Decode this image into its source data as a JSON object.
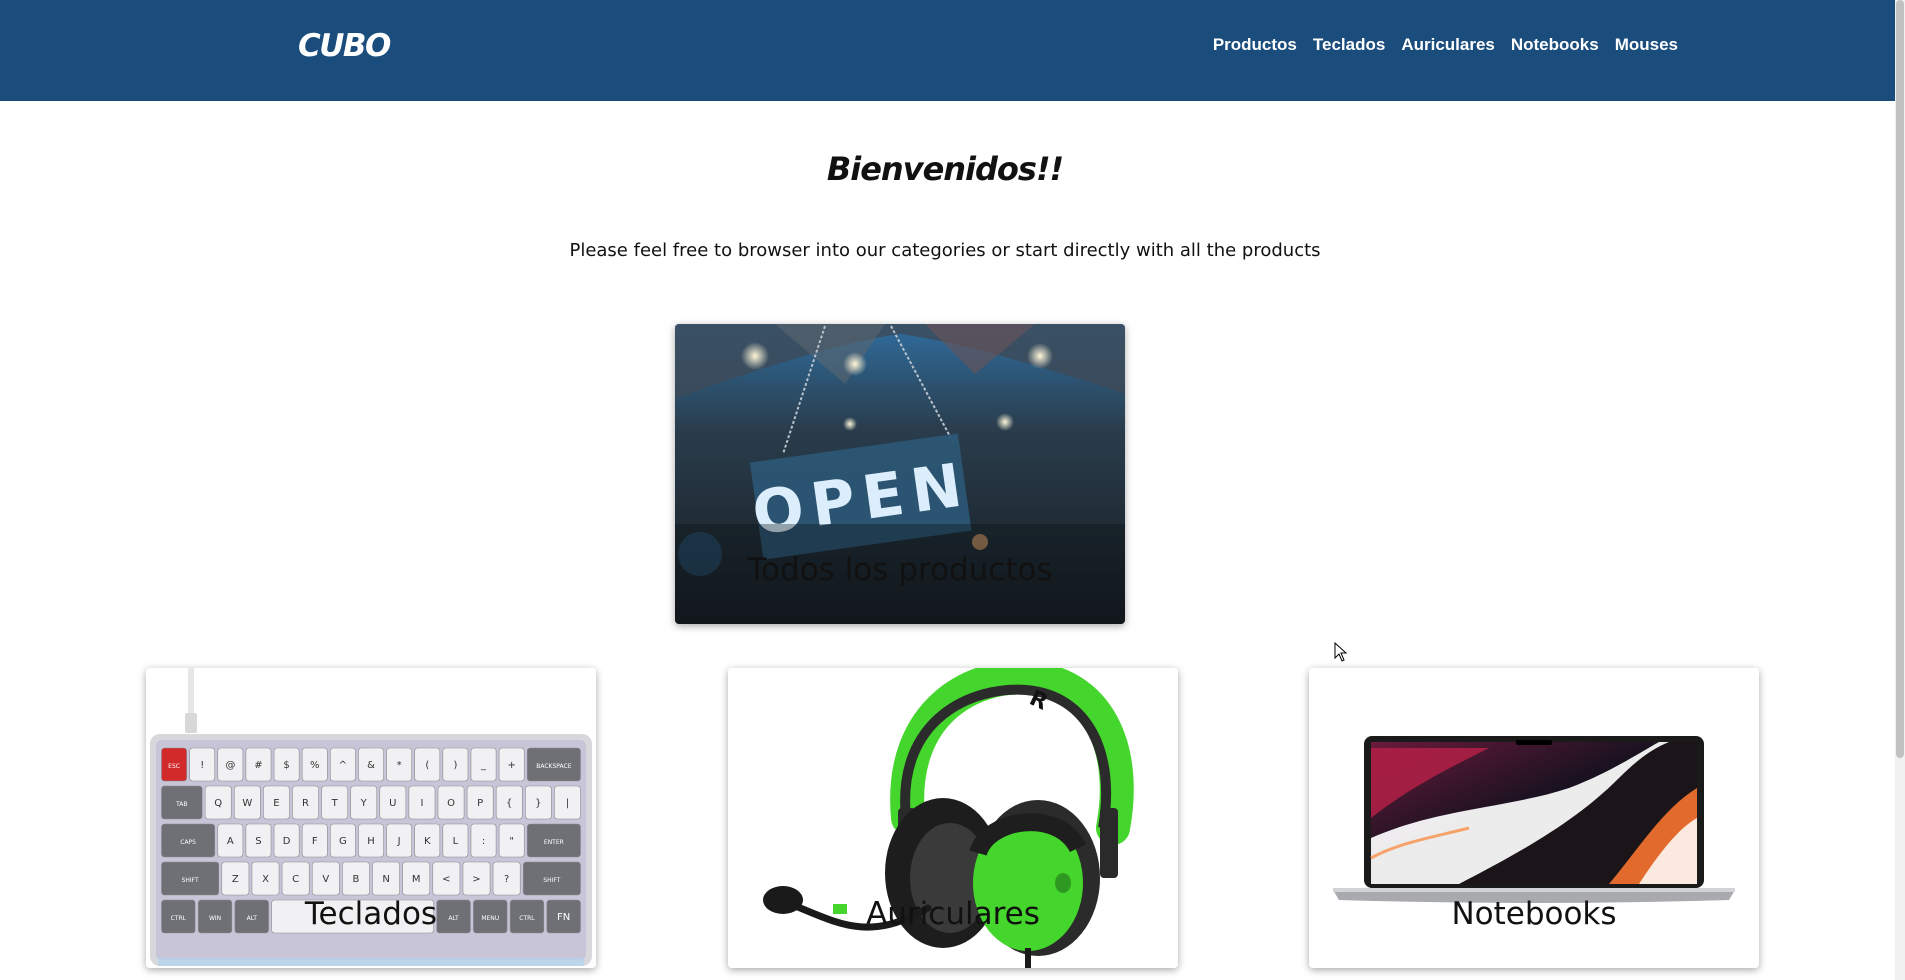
{
  "header": {
    "brand": "CUBO",
    "nav": [
      {
        "label": "Productos"
      },
      {
        "label": "Teclados"
      },
      {
        "label": "Auriculares"
      },
      {
        "label": "Notebooks"
      },
      {
        "label": "Mouses"
      }
    ],
    "background_color": "#1a4c7c"
  },
  "hero": {
    "title": "Bienvenidos!!",
    "subtitle": "Please feel free to browser into our categories or start directly with all the products"
  },
  "categories": {
    "all": {
      "label": "Todos los productos",
      "sign_text": "OPEN",
      "image": "open-sign-photo"
    },
    "items": [
      {
        "label": "Teclados",
        "image": "keyboard-photo"
      },
      {
        "label": "Auriculares",
        "image": "headphones-photo"
      },
      {
        "label": "Notebooks",
        "image": "laptop-photo"
      }
    ]
  },
  "keyboard_keys": {
    "row1": [
      "ESC",
      "!",
      "@",
      "#",
      "$",
      "%",
      "^",
      "&",
      "*",
      "(",
      ")",
      "_",
      "+",
      "BACKSPACE"
    ],
    "row2": [
      "TAB",
      "Q",
      "W",
      "E",
      "R",
      "T",
      "Y",
      "U",
      "I",
      "O",
      "P",
      "{",
      "}",
      "|"
    ],
    "row3": [
      "CAPS",
      "A",
      "S",
      "D",
      "F",
      "G",
      "H",
      "J",
      "K",
      "L",
      ":",
      "\"",
      "ENTER"
    ],
    "row4": [
      "SHIFT",
      "Z",
      "X",
      "C",
      "V",
      "B",
      "N",
      "M",
      "<",
      ">",
      "?",
      "SHIFT"
    ],
    "row5": [
      "CTRL",
      "WIN",
      "ALT",
      "",
      "ALT",
      "MENU",
      "CTRL",
      "FN"
    ]
  },
  "colors": {
    "accent_green": "#44d62c",
    "text_dark": "#111111"
  }
}
